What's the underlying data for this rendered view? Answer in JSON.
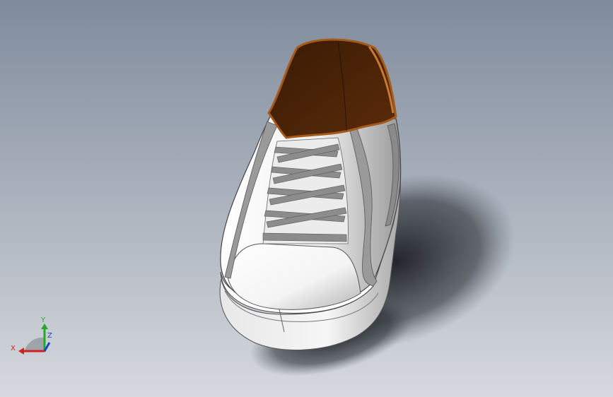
{
  "viewport": {
    "background_top": "#7f8b9c",
    "background_bottom": "#d6d9de"
  },
  "model": {
    "upper_color": "#f2f2f2",
    "lining_color": "#4a2408",
    "lining_edge_color": "#a55a1c",
    "lace_color": "#8c8c8c",
    "sole_color": "#e6e6e6"
  },
  "triad": {
    "x_label": "X",
    "y_label": "Y",
    "z_label": "Z",
    "x_color": "#d42020",
    "y_color": "#22aa22",
    "z_color": "#2040c8"
  }
}
